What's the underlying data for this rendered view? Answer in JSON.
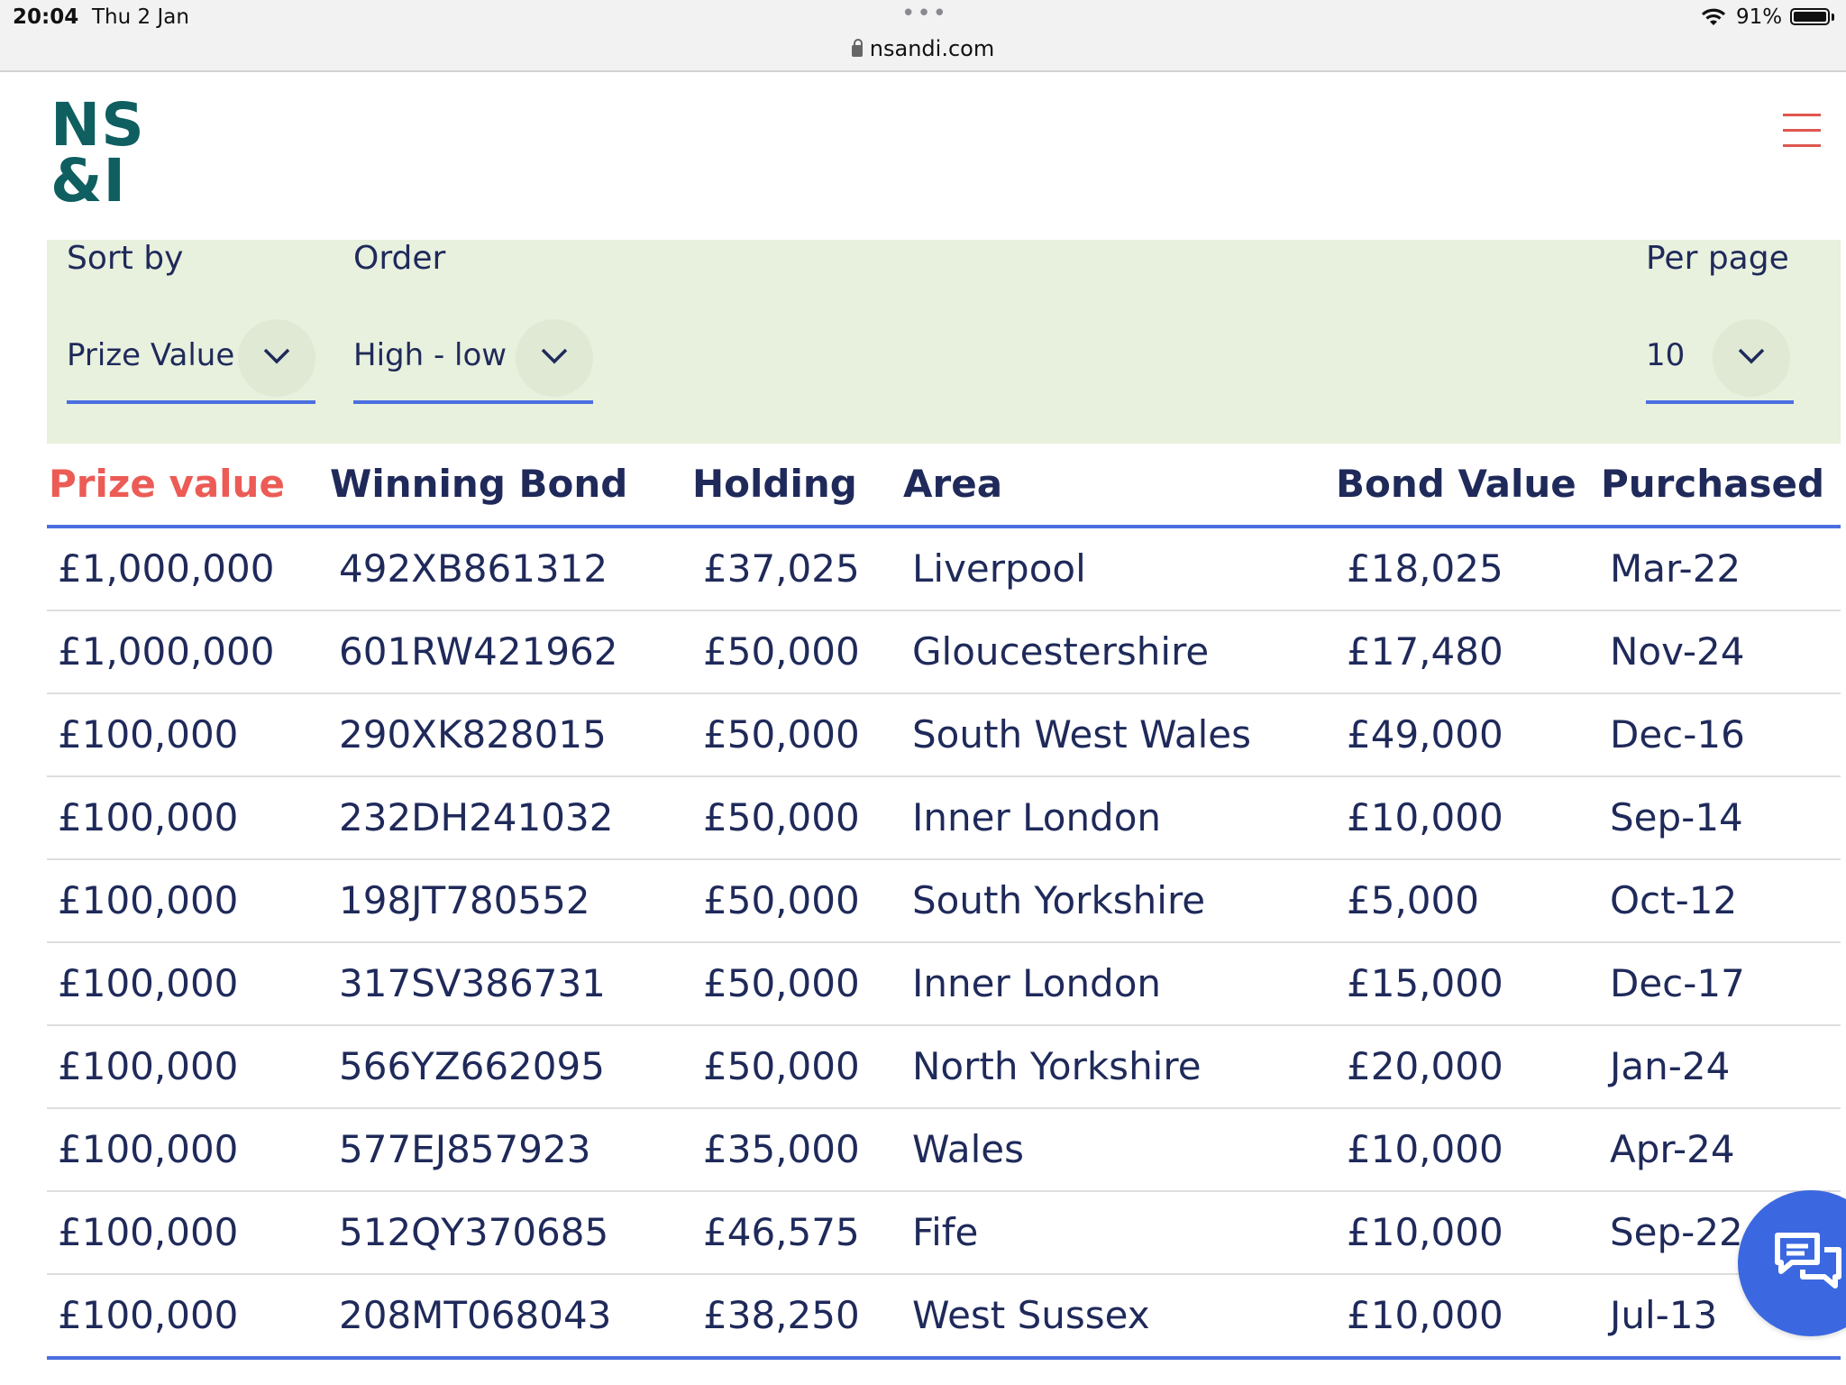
{
  "status_bar": {
    "time": "20:04",
    "date": "Thu 2 Jan",
    "url": "nsandi.com",
    "battery_percent": "91%"
  },
  "header": {
    "logo_line1": "NS",
    "logo_line2": "&I",
    "logo_color": "#0f5e60",
    "menu_icon": "hamburger-menu-icon",
    "menu_color": "#e0574f"
  },
  "filters": {
    "sort_by": {
      "label": "Sort by",
      "value": "Prize Value"
    },
    "order": {
      "label": "Order",
      "value": "High - low"
    },
    "per_page": {
      "label": "Per page",
      "value": "10"
    },
    "background": "#e8f0de",
    "underline_color": "#4b6fe0"
  },
  "table": {
    "columns": [
      "Prize value",
      "Winning Bond",
      "Holding",
      "Area",
      "Bond Value",
      "Purchased"
    ],
    "active_column": "Prize value",
    "active_color": "#ec5b55",
    "rows": [
      [
        "£1,000,000",
        "492XB861312",
        "£37,025",
        "Liverpool",
        "£18,025",
        "Mar-22"
      ],
      [
        "£1,000,000",
        "601RW421962",
        "£50,000",
        "Gloucestershire",
        "£17,480",
        "Nov-24"
      ],
      [
        "£100,000",
        "290XK828015",
        "£50,000",
        "South West Wales",
        "£49,000",
        "Dec-16"
      ],
      [
        "£100,000",
        "232DH241032",
        "£50,000",
        "Inner London",
        "£10,000",
        "Sep-14"
      ],
      [
        "£100,000",
        "198JT780552",
        "£50,000",
        "South Yorkshire",
        "£5,000",
        "Oct-12"
      ],
      [
        "£100,000",
        "317SV386731",
        "£50,000",
        "Inner London",
        "£15,000",
        "Dec-17"
      ],
      [
        "£100,000",
        "566YZ662095",
        "£50,000",
        "North Yorkshire",
        "£20,000",
        "Jan-24"
      ],
      [
        "£100,000",
        "577EJ857923",
        "£35,000",
        "Wales",
        "£10,000",
        "Apr-24"
      ],
      [
        "£100,000",
        "512QY370685",
        "£46,575",
        "Fife",
        "£10,000",
        "Sep-22"
      ],
      [
        "£100,000",
        "208MT068043",
        "£38,250",
        "West Sussex",
        "£10,000",
        "Jul-13"
      ]
    ]
  },
  "chat": {
    "icon": "chat-bubbles-icon",
    "color": "#3b68e0"
  }
}
